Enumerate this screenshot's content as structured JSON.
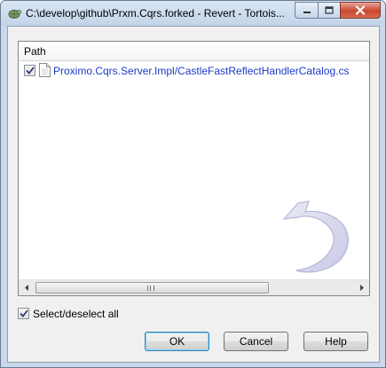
{
  "window": {
    "title": "C:\\develop\\github\\Prxm.Cqrs.forked - Revert - Tortois..."
  },
  "list": {
    "column_header": "Path",
    "rows": [
      {
        "checked": true,
        "path": "Proximo.Cqrs.Server.Impl/CastleFastReflectHandlerCatalog.cs"
      }
    ]
  },
  "select_all": {
    "label": "Select/deselect all",
    "checked": true
  },
  "buttons": {
    "ok": "OK",
    "cancel": "Cancel",
    "help": "Help"
  },
  "colors": {
    "file_link": "#1c3bc6",
    "ok_focus": "#3c7fb1",
    "close_button": "#c9462f"
  }
}
